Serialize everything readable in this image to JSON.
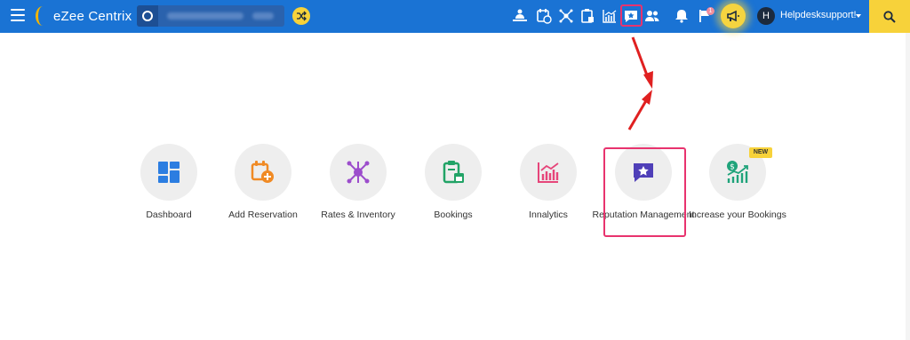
{
  "header": {
    "brand": "eZee Centrix",
    "user_initial": "H",
    "user_name": "Helpdesksupport!",
    "notification_count": "1"
  },
  "modules": [
    {
      "label": "Dashboard"
    },
    {
      "label": "Add Reservation"
    },
    {
      "label": "Rates & Inventory"
    },
    {
      "label": "Bookings"
    },
    {
      "label": "Innalytics"
    },
    {
      "label": "Reputation Management"
    },
    {
      "label": "Increase your Bookings",
      "badge": "NEW"
    }
  ],
  "colors": {
    "header_bg": "#1a73d4",
    "accent_yellow": "#f7d23a",
    "highlight": "#e8336e"
  }
}
